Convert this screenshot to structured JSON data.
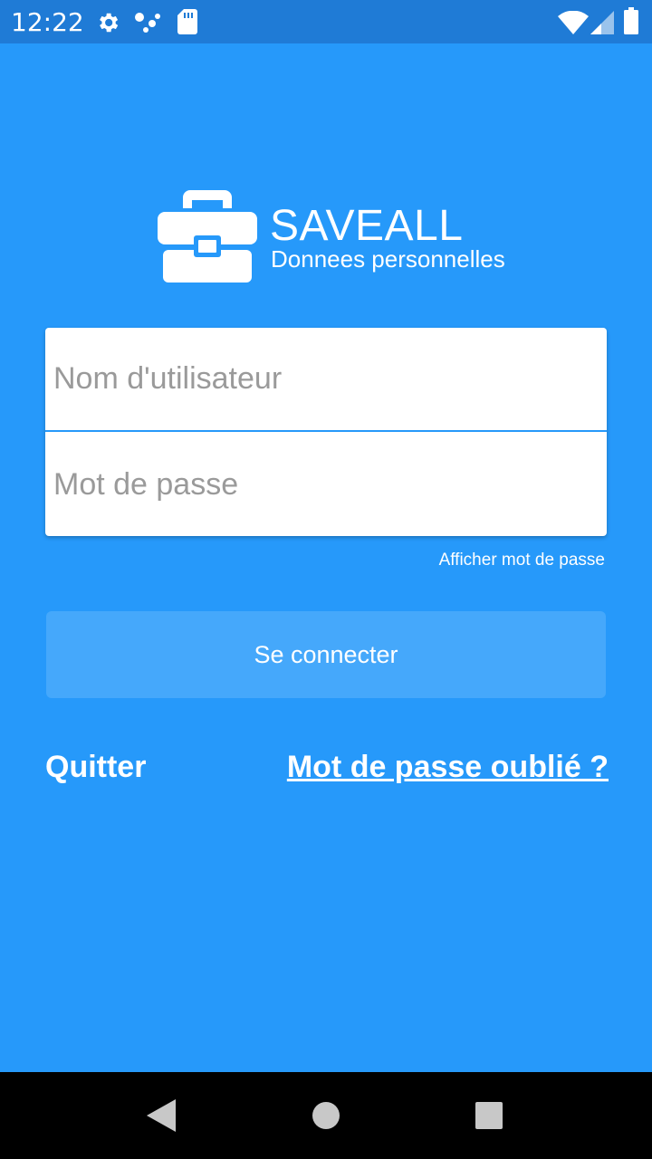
{
  "status_bar": {
    "time": "12:22",
    "icons": [
      "settings-icon",
      "notification-dots-icon",
      "sd-card-icon",
      "wifi-icon",
      "signal-icon",
      "battery-icon"
    ]
  },
  "app": {
    "title": "SAVEALL",
    "subtitle": "Donnees personnelles",
    "logo_icon": "briefcase-icon"
  },
  "form": {
    "username_placeholder": "Nom d'utilisateur",
    "username_value": "",
    "password_placeholder": "Mot de passe",
    "password_value": "",
    "show_password_label": "Afficher mot de passe"
  },
  "actions": {
    "login_label": "Se connecter",
    "quit_label": "Quitter",
    "forgot_label": "Mot de passe oublié ?"
  },
  "nav_bar": {
    "buttons": [
      "back-icon",
      "home-icon",
      "recents-icon"
    ]
  },
  "colors": {
    "background": "#2699FA",
    "status_bar": "#1F7BD6",
    "button": "#45A8FB",
    "nav_bar": "#000000"
  }
}
